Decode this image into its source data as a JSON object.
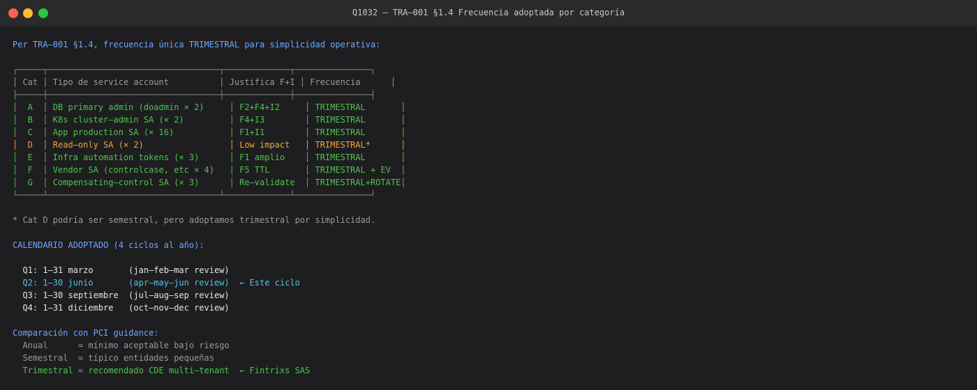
{
  "window": {
    "title": "Q1032 — TRA—001 §1.4 Frecuencia adoptada por categoría"
  },
  "terminal": {
    "intro": "Per TRA—001 §1.4, frecuencia única TRIMESTRAL para simplicidad operativa:",
    "table": {
      "top_border": "┌─────┬──────────────────────────────────┬─────────────┬───────────────┐",
      "header": "│ Cat │ Tipo de service account          │ Justifica F+I │ Frecuencia      │",
      "separator": "├─────┼──────────────────────────────────┼─────────────┼───────────────┤",
      "rows": [
        "│  A  │ DB primary admin (doadmin × 2)     │ F2+F4+I2     │ TRIMESTRAL       │",
        "│  B  │ K8s cluster—admin SA (× 2)         │ F4+I3        │ TRIMESTRAL       │",
        "│  C  │ App production SA (× 16)           │ F1+I1        │ TRIMESTRAL       │",
        "│  D  │ Read—only SA (× 2)                 │ Low impact   │ TRIMESTRAL*      │",
        "│  E  │ Infra automation tokens (× 3)      │ F1 amplio    │ TRIMESTRAL       │",
        "│  F  │ Vendor SA (controlcase, etc × 4)   │ F5 TTL       │ TRIMESTRAL + EV  │",
        "│  G  │ Compensating—control SA (× 3)      │ Re—validate  │ TRIMESTRAL+ROTATE│"
      ],
      "bottom_border": "└─────┴──────────────────────────────────┴─────────────┴───────────────┘"
    },
    "footnote": "* Cat D podría ser semestral, pero adoptamos trimestral por simplicidad.",
    "calendar_heading": "CALENDARIO ADOPTADO (4 ciclos al año):",
    "calendar": [
      "  Q1: 1—31 marzo       (jan—feb—mar review)",
      "  Q2: 1—30 junio       (apr—may—jun review)  ← Este ciclo",
      "  Q3: 1—30 septiembre  (jul—aug—sep review)",
      "  Q4: 1—31 diciembre   (oct—nov—dec review)"
    ],
    "comparison_heading": "Comparación con PCI guidance:",
    "comparison": [
      "  Anual      = mínimo aceptable bajo riesgo",
      "  Semestral  = típico entidades pequeñas",
      "  Trimestral = recomendado CDE multi—tenant  ← Fintrixs SAS"
    ]
  },
  "colors": {
    "background": "#1e1e20",
    "titlebar": "#2a2a2d",
    "heading_blue": "#6fa8ff",
    "row_green": "#4ec34e",
    "row_highlight_orange": "#f0a43a",
    "muted_gray": "#9a9a9a",
    "current_cycle_cyan": "#4fc3e8"
  }
}
